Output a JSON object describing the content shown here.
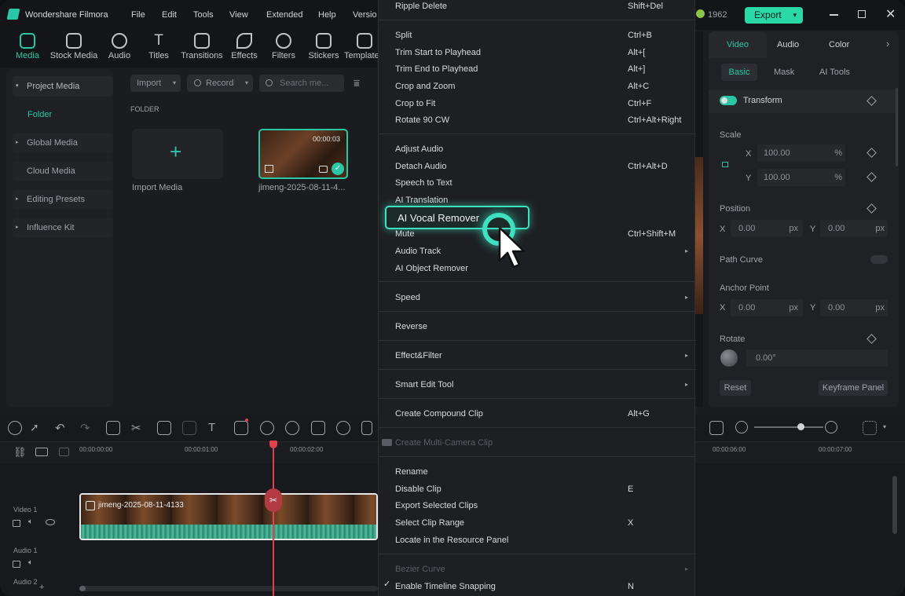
{
  "app": {
    "title": "Wondershare Filmora",
    "menu": [
      "File",
      "Edit",
      "Tools",
      "View",
      "Extended",
      "Help",
      "Version"
    ],
    "credits": "1962",
    "export_label": "Export"
  },
  "toolbar": {
    "items": [
      {
        "label": "Media",
        "active": true
      },
      {
        "label": "Stock Media"
      },
      {
        "label": "Audio"
      },
      {
        "label": "Titles"
      },
      {
        "label": "Transitions"
      },
      {
        "label": "Effects"
      },
      {
        "label": "Filters"
      },
      {
        "label": "Stickers"
      },
      {
        "label": "Templates"
      }
    ]
  },
  "sidebar": {
    "items": [
      {
        "label": "Project Media"
      },
      {
        "label": "Folder"
      },
      {
        "label": "Global Media"
      },
      {
        "label": "Cloud Media"
      },
      {
        "label": "Editing Presets"
      },
      {
        "label": "Influence Kit"
      }
    ]
  },
  "media": {
    "import_label": "Import",
    "record_label": "Record",
    "search_placeholder": "Search me...",
    "folder_heading": "FOLDER",
    "import_media_label": "Import Media",
    "clip_name": "jimeng-2025-08-11-4...",
    "clip_duration": "00:00:03"
  },
  "properties": {
    "tabs": [
      "Video",
      "Audio",
      "Color"
    ],
    "subtabs": [
      "Basic",
      "Mask",
      "AI Tools"
    ],
    "transform_label": "Transform",
    "scale_label": "Scale",
    "scale_x": "100.00",
    "scale_y": "100.00",
    "percent": "%",
    "position_label": "Position",
    "pos_x": "0.00",
    "pos_y": "0.00",
    "px": "px",
    "x_label": "X",
    "y_label": "Y",
    "path_curve_label": "Path Curve",
    "anchor_label": "Anchor Point",
    "anchor_x": "0.00",
    "anchor_y": "0.00",
    "rotate_label": "Rotate",
    "rotate_value": "0.00°",
    "reset_label": "Reset",
    "keyframe_label": "Keyframe Panel"
  },
  "timeline": {
    "ticks": [
      "00:00:00:00",
      "00:00:01:00",
      "00:00:02:00",
      "00:00:06:00",
      "00:00:07:00"
    ],
    "tracks": [
      "Video 1",
      "Audio 1",
      "Audio 2"
    ],
    "clip_label": "jimeng-2025-08-11-4133"
  },
  "context_menu": {
    "items": [
      {
        "label": "Ripple Delete",
        "shortcut": "Shift+Del"
      },
      {
        "label": "Split",
        "shortcut": "Ctrl+B"
      },
      {
        "label": "Trim Start to Playhead",
        "shortcut": "Alt+["
      },
      {
        "label": "Trim End to Playhead",
        "shortcut": "Alt+]"
      },
      {
        "label": "Crop and Zoom",
        "shortcut": "Alt+C"
      },
      {
        "label": "Crop to Fit",
        "shortcut": "Ctrl+F"
      },
      {
        "label": "Rotate 90 CW",
        "shortcut": "Ctrl+Alt+Right"
      },
      {
        "label": "Adjust Audio",
        "shortcut": ""
      },
      {
        "label": "Detach Audio",
        "shortcut": "Ctrl+Alt+D"
      },
      {
        "label": "Speech to Text",
        "shortcut": ""
      },
      {
        "label": "AI Translation",
        "shortcut": ""
      },
      {
        "label": "AI Vocal Remover",
        "shortcut": ""
      },
      {
        "label": "Mute",
        "shortcut": "Ctrl+Shift+M"
      },
      {
        "label": "Audio Track",
        "shortcut": ""
      },
      {
        "label": "AI Object Remover",
        "shortcut": ""
      },
      {
        "label": "Speed",
        "shortcut": ""
      },
      {
        "label": "Reverse",
        "shortcut": ""
      },
      {
        "label": "Effect&Filter",
        "shortcut": ""
      },
      {
        "label": "Smart Edit Tool",
        "shortcut": ""
      },
      {
        "label": "Create Compound Clip",
        "shortcut": "Alt+G"
      },
      {
        "label": "Create Multi-Camera Clip",
        "shortcut": ""
      },
      {
        "label": "Rename",
        "shortcut": ""
      },
      {
        "label": "Disable Clip",
        "shortcut": "E"
      },
      {
        "label": "Export Selected Clips",
        "shortcut": ""
      },
      {
        "label": "Select Clip Range",
        "shortcut": "X"
      },
      {
        "label": "Locate in the Resource Panel",
        "shortcut": ""
      },
      {
        "label": "Bezier Curve",
        "shortcut": ""
      },
      {
        "label": "Enable Timeline Snapping",
        "shortcut": "N"
      }
    ]
  },
  "colors": {
    "accent": "#29c7a5",
    "export_bg": "#2bd9a6",
    "menu_bg": "#1e1f23",
    "highlight_border": "#3fe0c0",
    "playhead": "#e0414b"
  }
}
